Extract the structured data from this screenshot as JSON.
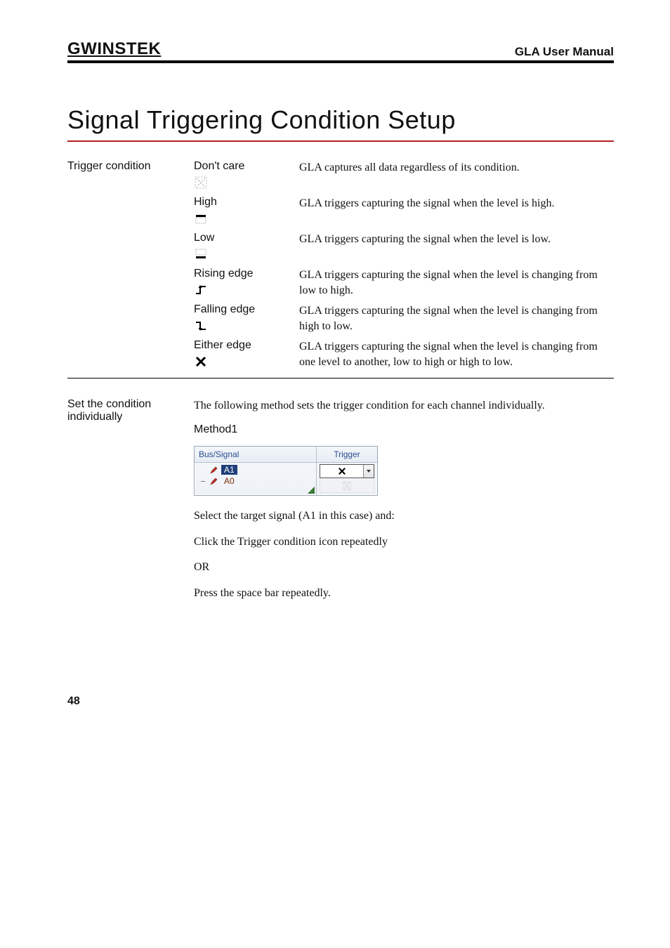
{
  "header": {
    "brand": "GWINSTEK",
    "manual": "GLA User Manual"
  },
  "title": "Signal Triggering Condition Setup",
  "trigger": {
    "side_label": "Trigger condition",
    "conditions": [
      {
        "name": "Don't care",
        "icon": "dont-care-icon",
        "desc": "GLA captures all data regardless of its condition."
      },
      {
        "name": "High",
        "icon": "high-level-icon",
        "desc": "GLA triggers capturing the signal when the level is high."
      },
      {
        "name": "Low",
        "icon": "low-level-icon",
        "desc": "GLA triggers capturing the signal when the level is low."
      },
      {
        "name": "Rising edge",
        "icon": "rising-edge-icon",
        "desc": "GLA triggers capturing the signal when the level is changing from low to high."
      },
      {
        "name": "Falling edge",
        "icon": "falling-edge-icon",
        "desc": "GLA triggers capturing the signal when the level is changing from high to low."
      },
      {
        "name": "Either edge",
        "icon": "either-edge-icon",
        "desc": "GLA triggers capturing the signal when the level is changing from one level to another, low to high or high to low."
      }
    ]
  },
  "set_individually": {
    "side_label": "Set the condition individually",
    "intro": "The following method sets the trigger condition for each channel individually.",
    "method_heading": "Method1",
    "ui": {
      "bus_header": "Bus/Signal",
      "trigger_header": "Trigger",
      "row1": "A1",
      "row2": "A0",
      "tree_expand": "−"
    },
    "step1": "Select the target signal (A1 in this case) and:",
    "step2": "Click the Trigger condition icon repeatedly",
    "or": "OR",
    "step3": "Press the space bar repeatedly."
  },
  "page_number": "48"
}
